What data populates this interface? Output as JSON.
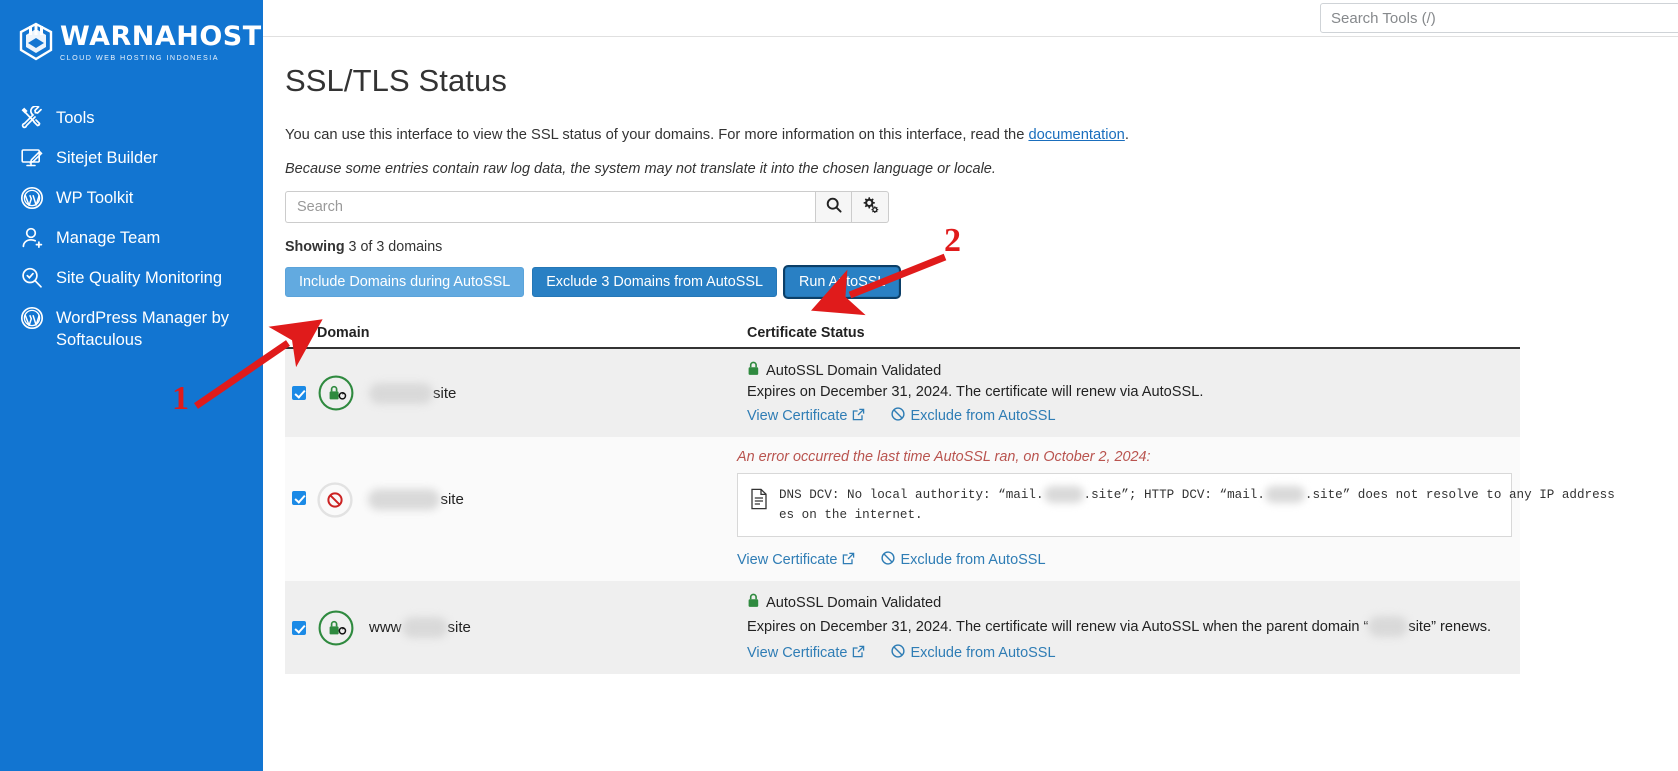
{
  "sidebar": {
    "brand": {
      "name": "WARNAHOST",
      "tagline": "CLOUD WEB HOSTING INDONESIA"
    },
    "items": [
      {
        "label": "Tools",
        "icon": "tools-icon"
      },
      {
        "label": "Sitejet Builder",
        "icon": "monitor-pen-icon"
      },
      {
        "label": "WP Toolkit",
        "icon": "wordpress-icon"
      },
      {
        "label": "Manage Team",
        "icon": "user-plus-icon"
      },
      {
        "label": "Site Quality Monitoring",
        "icon": "magnifier-check-icon"
      },
      {
        "label": "WordPress Manager by Softaculous",
        "icon": "wordpress-icon"
      }
    ]
  },
  "topbar": {
    "search_placeholder": "Search Tools (/)",
    "search_value": ""
  },
  "page": {
    "title": "SSL/TLS Status",
    "intro_before": "You can use this interface to view the SSL status of your domains. For more information on this interface, read the ",
    "intro_link": "documentation",
    "intro_after": ".",
    "note": "Because some entries contain raw log data, the system may not translate it into the chosen language or locale."
  },
  "filter": {
    "search_placeholder": "Search",
    "search_value": "",
    "search_icon": "search-icon",
    "settings_icon": "gears-icon"
  },
  "showing": {
    "label": "Showing",
    "text": "3 of 3 domains"
  },
  "actions": {
    "include": "Include Domains during AutoSSL",
    "exclude": "Exclude 3 Domains from AutoSSL",
    "run": "Run AutoSSL"
  },
  "table": {
    "headers": {
      "domain": "Domain",
      "status": "Certificate Status"
    },
    "rows": [
      {
        "checked": true,
        "badge": "green-lock-renew-icon",
        "domain_prefix": "",
        "domain_redacted_width": 64,
        "domain_suffix": "site",
        "status_icon": "green-padlock-icon",
        "status_title": "AutoSSL Domain Validated",
        "status_detail": "Expires on December 31, 2024. The certificate will renew via AutoSSL.",
        "has_error": false,
        "links": [
          {
            "label": "View Certificate",
            "icon": "external-link-icon"
          },
          {
            "label": "Exclude from AutoSSL",
            "icon": "ban-icon"
          }
        ]
      },
      {
        "checked": true,
        "badge": "red-ban-icon",
        "domain_prefix": "",
        "domain_redacted_width": 72,
        "domain_suffix": "site",
        "has_error": true,
        "error_title": "An error occurred the last time AutoSSL ran, on October 2, 2024:",
        "error_icon": "document-icon",
        "error_part1": "DNS DCV: No local authority: “mail.",
        "error_part2": ".site”; HTTP DCV: “mail.",
        "error_part3": ".site” does not resolve to any IP address",
        "error_part4": "es on the internet.",
        "links": [
          {
            "label": "View Certificate",
            "icon": "external-link-icon"
          },
          {
            "label": "Exclude from AutoSSL",
            "icon": "ban-icon"
          }
        ]
      },
      {
        "checked": true,
        "badge": "green-lock-renew-icon",
        "domain_prefix": "www",
        "domain_redacted_width": 46,
        "domain_suffix": "site",
        "status_icon": "green-padlock-icon",
        "status_title": "AutoSSL Domain Validated",
        "status_detail_a": "Expires on December 31, 2024. The certificate will renew via AutoSSL when the parent domain “",
        "status_detail_b": "site” renews.",
        "has_error": false,
        "links": [
          {
            "label": "View Certificate",
            "icon": "external-link-icon"
          },
          {
            "label": "Exclude from AutoSSL",
            "icon": "ban-icon"
          }
        ]
      }
    ]
  },
  "annotations": [
    {
      "number": "1",
      "color": "#e01b1b"
    },
    {
      "number": "2",
      "color": "#e01b1b"
    }
  ],
  "colors": {
    "sidebar_bg": "#1275d1",
    "primary_btn": "#2980c4",
    "light_btn": "#62aae0",
    "link": "#2f7db5",
    "error_text": "#b9544f",
    "valid_green": "#2f8a3f",
    "annotation_red": "#e01b1b"
  }
}
